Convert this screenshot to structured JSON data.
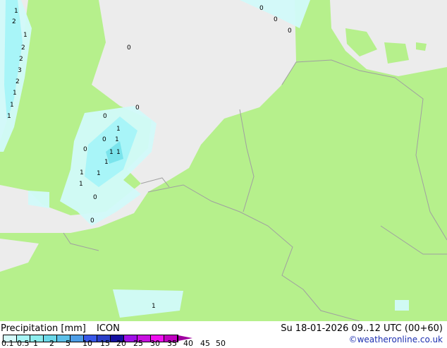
{
  "colors": {
    "land": "#b6f08c",
    "sea": "#ececec",
    "border": "#a0a0a0",
    "precip_light": "#d2fafa",
    "precip_mid": "#a8f5f8",
    "precip_heavy": "#7ae4ec"
  },
  "legend": {
    "title": "Precipitation [mm]",
    "model": "ICON",
    "datetime": "Su 18-01-2026 09..12 UTC (00+60)",
    "credit": "©weatheronline.co.uk",
    "ticks": [
      "0.1",
      "0.5",
      "1",
      "2",
      "5",
      "10",
      "15",
      "20",
      "25",
      "30",
      "35",
      "40",
      "45",
      "50"
    ],
    "colors": [
      "#d4fafa",
      "#a8f5f5",
      "#8ceded",
      "#6ad8e8",
      "#5cc0e8",
      "#4d9de6",
      "#3858e8",
      "#2a3fc8",
      "#1410a0",
      "#a010e8",
      "#c810e0",
      "#f010f0",
      "#c000c0"
    ],
    "arrow_color": "#a000a0"
  },
  "map_labels": [
    "1",
    "2",
    "1",
    "2",
    "2",
    "3",
    "2",
    "1",
    "1",
    "1",
    "1",
    "1",
    "1",
    "1",
    "1",
    "1",
    "1",
    "1",
    "1",
    "0",
    "0",
    "0",
    "0",
    "0",
    "0",
    "0",
    "0",
    "0",
    "0"
  ]
}
